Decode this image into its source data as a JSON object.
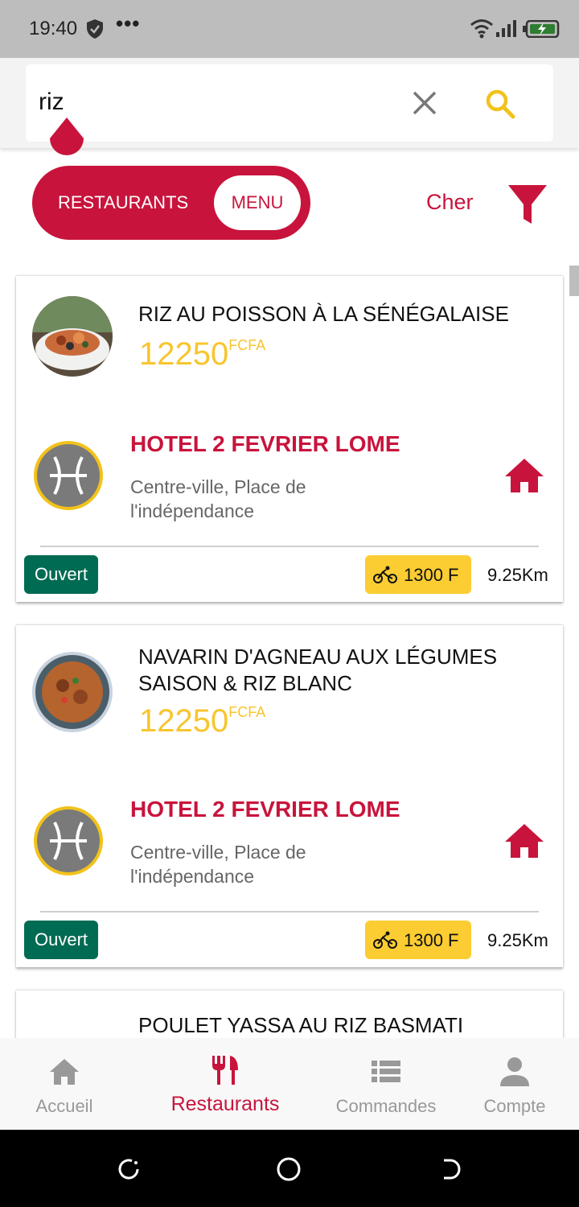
{
  "status_bar": {
    "time": "19:40",
    "dots": "•••"
  },
  "search": {
    "query": "riz"
  },
  "segment": {
    "restaurants_label": "RESTAURANTS",
    "menu_label": "MENU"
  },
  "sort": {
    "label": "Cher"
  },
  "results": [
    {
      "dish_name": "RIZ AU POISSON À LA SÉNÉGALAISE",
      "price": "12250",
      "currency": "FCFA",
      "restaurant": "HOTEL 2 FEVRIER LOME",
      "address": "Centre-ville, Place de l'indépendance",
      "status": "Ouvert",
      "delivery_fee": "1300 F",
      "distance": "9.25Km"
    },
    {
      "dish_name": "NAVARIN D'AGNEAU AUX LÉGUMES SAISON & RIZ BLANC",
      "price": "12250",
      "currency": "FCFA",
      "restaurant": "HOTEL 2 FEVRIER LOME",
      "address": "Centre-ville, Place de l'indépendance",
      "status": "Ouvert",
      "delivery_fee": "1300 F",
      "distance": "9.25Km"
    },
    {
      "dish_name": "POULET YASSA AU RIZ BASMATI"
    }
  ],
  "nav": [
    {
      "label": "Accueil",
      "icon": "home-icon"
    },
    {
      "label": "Restaurants",
      "icon": "fork-knife-icon"
    },
    {
      "label": "Commandes",
      "icon": "list-icon"
    },
    {
      "label": "Compte",
      "icon": "person-icon"
    }
  ],
  "colors": {
    "brand": "#c8143c",
    "price": "#f7c52e",
    "open": "#006b53",
    "delivery": "#fbcd32"
  }
}
